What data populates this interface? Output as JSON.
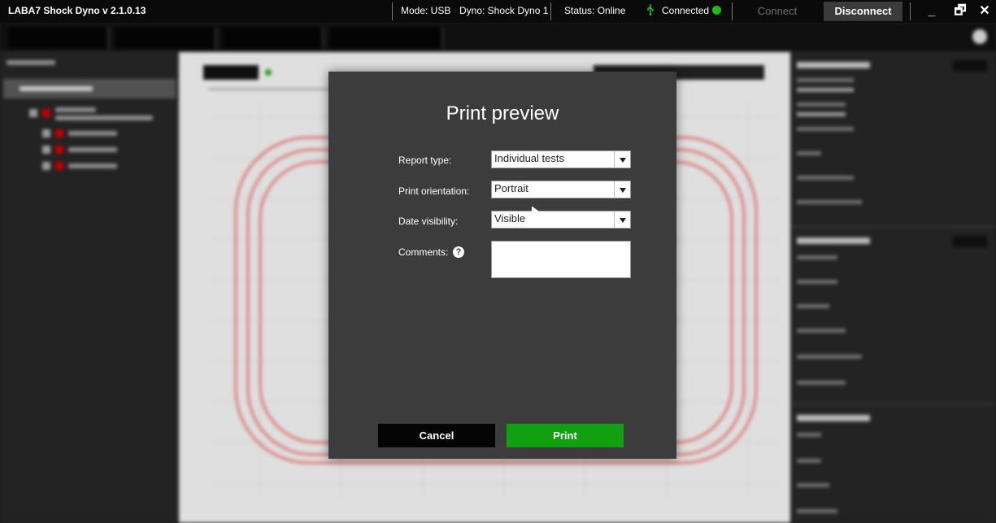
{
  "titlebar": {
    "app_title": "LABA7 Shock Dyno v 2.1.0.13",
    "mode": "Mode: USB",
    "dyno": "Dyno: Shock Dyno 1",
    "status": "Status: Online",
    "connected": "Connected",
    "connect_label": "Connect",
    "disconnect_label": "Disconnect",
    "minimize_glyph": "_",
    "restore_glyph": "🗗",
    "close_glyph": "✕",
    "status_color": "#1fb81f"
  },
  "modal": {
    "title": "Print preview",
    "report_type_label": "Report type:",
    "report_type_value": "Individual tests",
    "orientation_label": "Print orientation:",
    "orientation_value": "Portrait",
    "date_visibility_label": "Date visibility:",
    "date_visibility_value": "Visible",
    "comments_label": "Comments:",
    "comments_value": "",
    "help_glyph": "?",
    "cancel_label": "Cancel",
    "print_label": "Print",
    "print_color": "#10a010"
  }
}
